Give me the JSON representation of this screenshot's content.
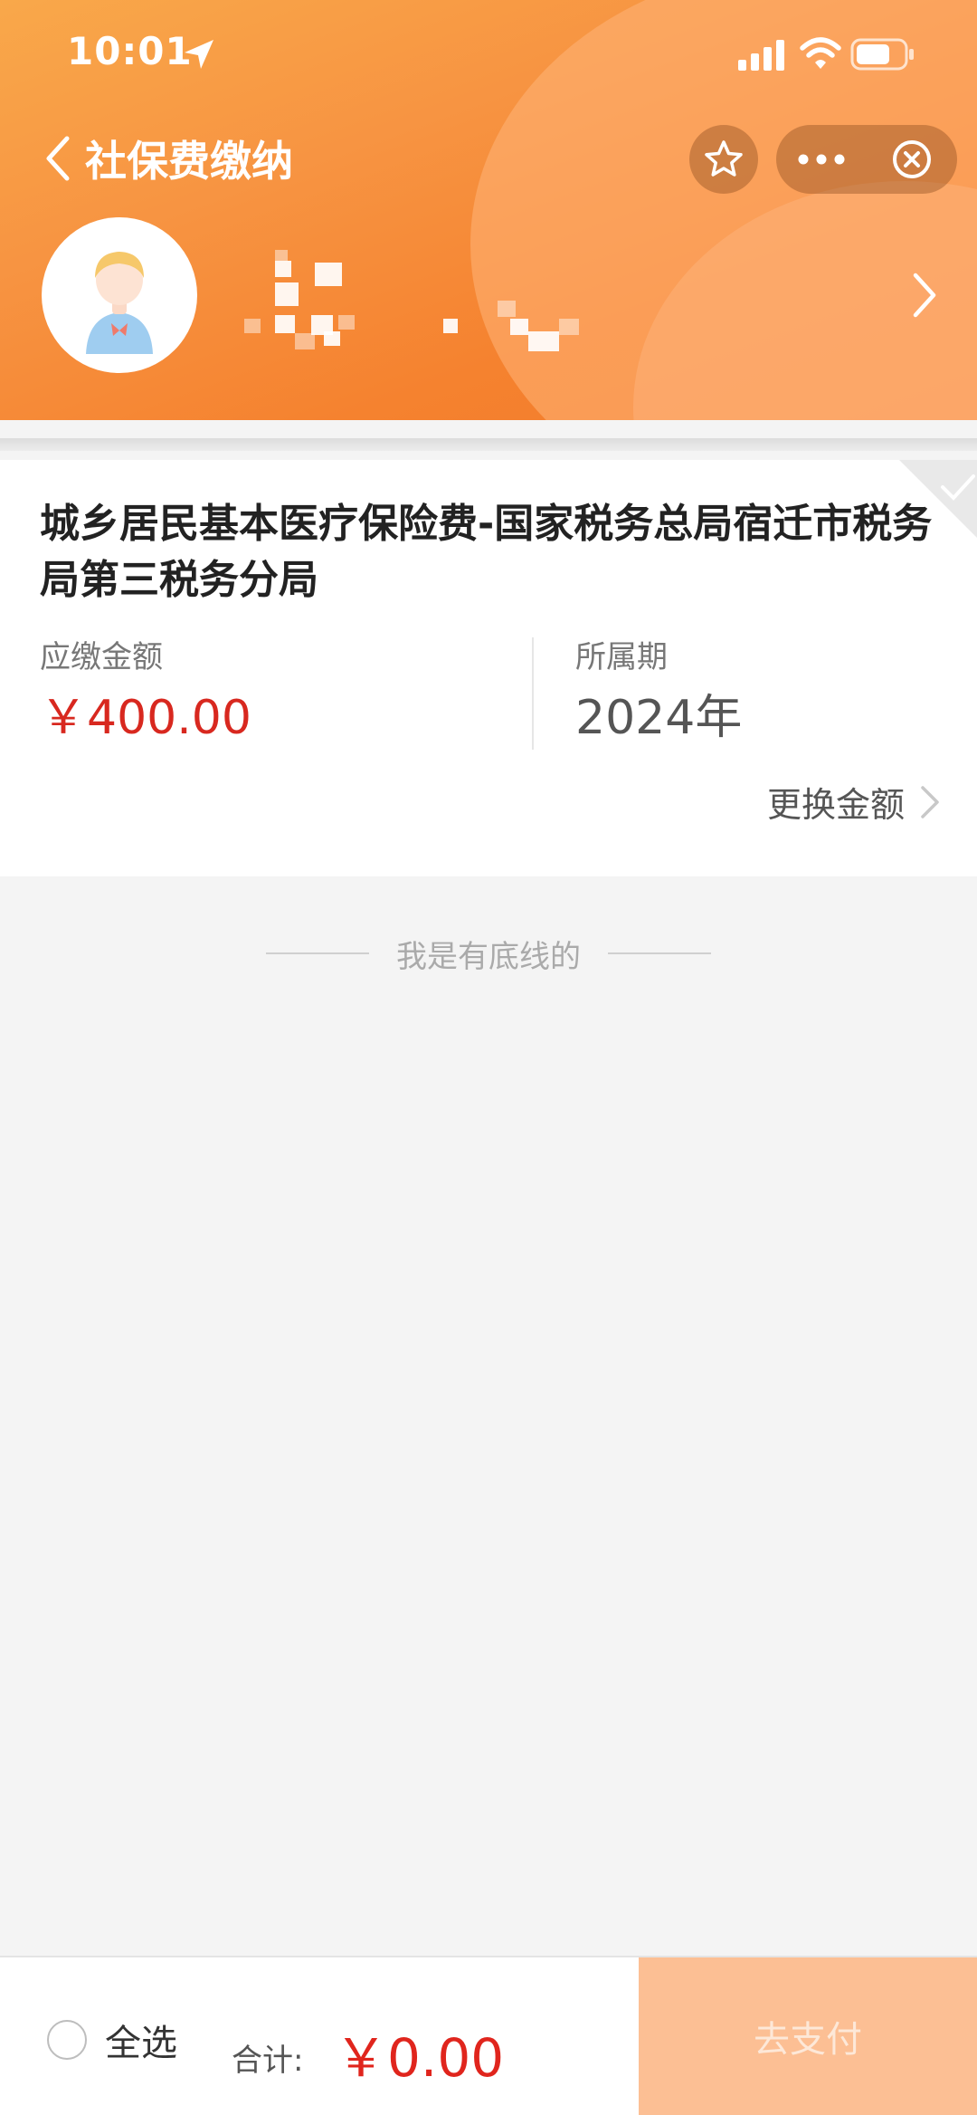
{
  "status_bar": {
    "time": "10:01"
  },
  "header": {
    "title": "社保费缴纳",
    "icons": [
      "back-chevron-icon",
      "star-icon",
      "more-icon",
      "close-circle-icon",
      "chevron-right-icon"
    ],
    "colors": {
      "gradient_start": "#f9a84a",
      "gradient_end": "#f37a2a"
    }
  },
  "bill": {
    "title": "城乡居民基本医疗保险费-国家税务总局宿迁市税务局第三税务分局",
    "amount_label": "应缴金额",
    "amount_value": "￥400.00",
    "period_label": "所属期",
    "period_value": "2024年",
    "change_amount_label": "更换金额"
  },
  "bottom_line_text": "我是有底线的",
  "footer": {
    "select_all_label": "全选",
    "total_label": "合计:",
    "total_value": "￥0.00",
    "pay_button_label": "去支付",
    "colors": {
      "price": "#e0251d",
      "pay_button_bg": "#fcbf94"
    }
  }
}
